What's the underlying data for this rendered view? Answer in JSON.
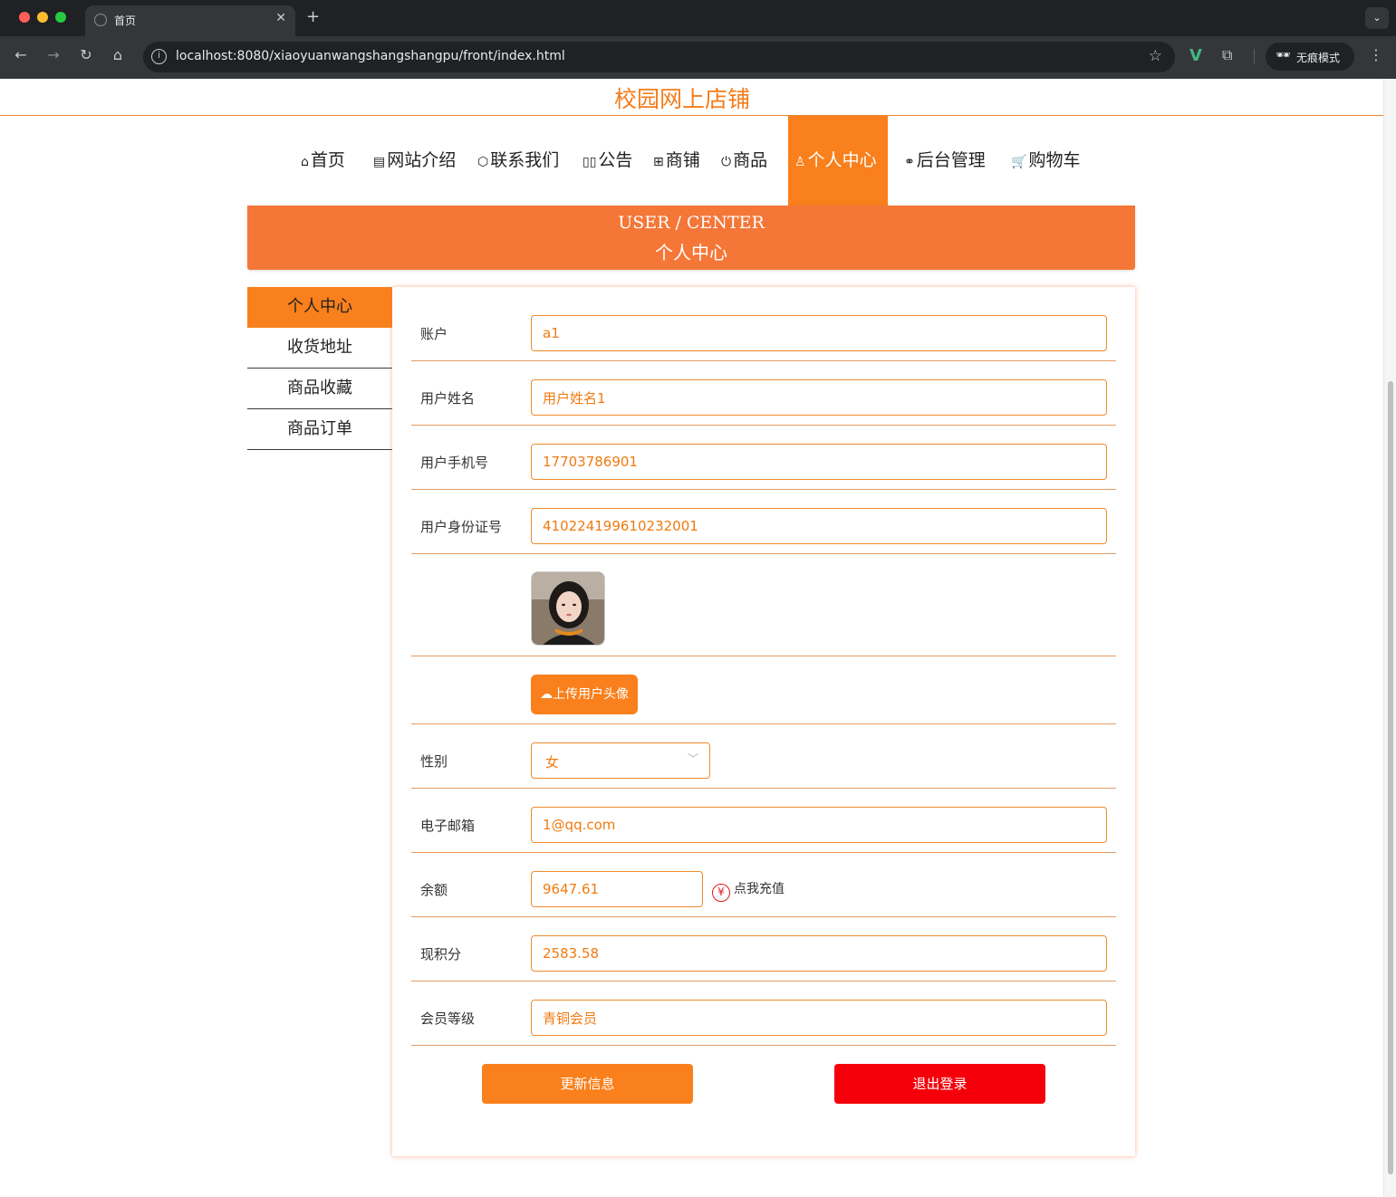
{
  "browser": {
    "tab_title": "首页",
    "tab_close": "✕",
    "new_tab": "+",
    "tab_menu": "⌄",
    "url": "localhost:8080/xiaoyuanwangshangshangpu/front/index.html",
    "incognito_label": "无痕模式"
  },
  "site": {
    "title": "校园网上店铺"
  },
  "nav": {
    "items": [
      {
        "icon": "⌂",
        "label": "首页"
      },
      {
        "icon": "▤",
        "label": "网站介绍"
      },
      {
        "icon": "⬡",
        "label": "联系我们"
      },
      {
        "icon": "▯▯",
        "label": "公告"
      },
      {
        "icon": "⊞",
        "label": "商铺"
      },
      {
        "icon": "⏻",
        "label": "商品"
      },
      {
        "icon": "♙",
        "label": "个人中心"
      },
      {
        "icon": "⚭",
        "label": "后台管理"
      },
      {
        "icon": "🛒",
        "label": "购物车"
      }
    ],
    "active_label": "个人中心"
  },
  "banner": {
    "en": "USER / CENTER",
    "cn": "个人中心"
  },
  "side_menu": {
    "items": [
      "个人中心",
      "收货地址",
      "商品收藏",
      "商品订单"
    ]
  },
  "form": {
    "account": {
      "label": "账户",
      "value": "a1"
    },
    "username": {
      "label": "用户姓名",
      "value": "用户姓名1"
    },
    "phone": {
      "label": "用户手机号",
      "value": "17703786901"
    },
    "id_number": {
      "label": "用户身份证号",
      "value": "410224199610232001"
    },
    "upload_label": "上传用户头像",
    "gender": {
      "label": "性别",
      "value": "女"
    },
    "email": {
      "label": "电子邮箱",
      "value": "1@qq.com"
    },
    "balance": {
      "label": "余额",
      "value": "9647.61",
      "recharge_label": "点我充值",
      "recharge_icon": "¥"
    },
    "points": {
      "label": "现积分",
      "value": "2583.58"
    },
    "level": {
      "label": "会员等级",
      "value": "青铜会员"
    },
    "update_button": "更新信息",
    "logout_button": "退出登录"
  },
  "colors": {
    "accent": "#f9801c",
    "banner": "#f57738",
    "logout": "#f5000a"
  }
}
